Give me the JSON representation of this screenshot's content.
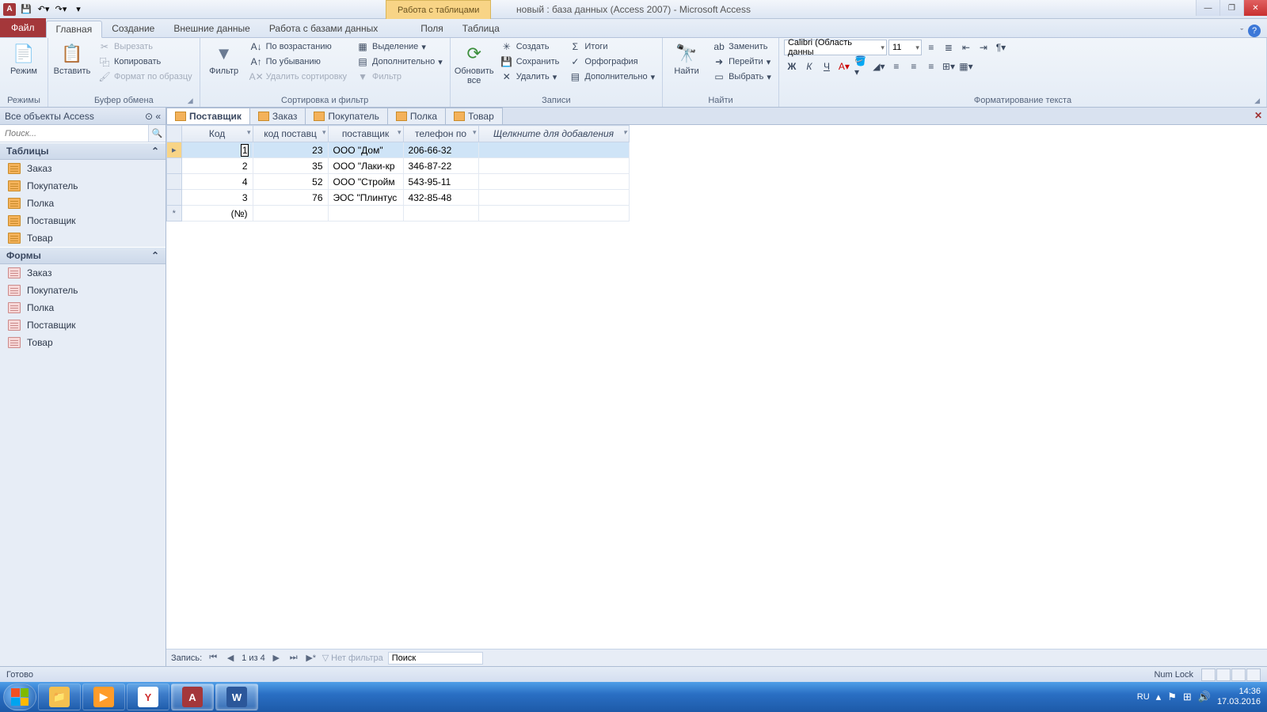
{
  "title": "новый : база данных (Access 2007)  -  Microsoft Access",
  "table_tools_label": "Работа с таблицами",
  "ribbon_tabs": {
    "file": "Файл",
    "items": [
      "Главная",
      "Создание",
      "Внешние данные",
      "Работа с базами данных",
      "Поля",
      "Таблица"
    ],
    "active_index": 0
  },
  "ribbon": {
    "modes": {
      "big": "Режим",
      "group": "Режимы"
    },
    "clipboard": {
      "big": "Вставить",
      "cut": "Вырезать",
      "copy": "Копировать",
      "format": "Формат по образцу",
      "group": "Буфер обмена"
    },
    "sort": {
      "filter": "Фильтр",
      "asc": "По возрастанию",
      "desc": "По убыванию",
      "clear": "Удалить сортировку",
      "group": "Сортировка и фильтр",
      "select": "Выделение",
      "adv": "Дополнительно",
      "toggle": "Фильтр"
    },
    "records": {
      "refresh": "Обновить\nвсе",
      "new": "Создать",
      "save": "Сохранить",
      "delete": "Удалить",
      "totals": "Итоги",
      "spell": "Орфография",
      "more": "Дополнительно",
      "group": "Записи"
    },
    "find": {
      "find": "Найти",
      "replace": "Заменить",
      "goto": "Перейти",
      "select": "Выбрать",
      "group": "Найти"
    },
    "text": {
      "group": "Форматирование текста",
      "font": "Calibri (Область данны",
      "size": "11"
    }
  },
  "nav": {
    "header": "Все объекты Access",
    "search_ph": "Поиск...",
    "groups": [
      {
        "title": "Таблицы",
        "items": [
          "Заказ",
          "Покупатель",
          "Полка",
          "Поставщик",
          "Товар"
        ]
      },
      {
        "title": "Формы",
        "items": [
          "Заказ",
          "Покупатель",
          "Полка",
          "Поставщик",
          "Товар"
        ]
      }
    ]
  },
  "doc_tabs": [
    "Поставщик",
    "Заказ",
    "Покупатель",
    "Полка",
    "Товар"
  ],
  "doc_active": 0,
  "datasheet": {
    "columns": [
      "Код",
      "код поставц",
      "поставщик",
      "телефон по"
    ],
    "add_col": "Щелкните для добавления",
    "rows": [
      {
        "sel": true,
        "id": "1",
        "code": "23",
        "name": "ООО \"Дом\"",
        "phone": "206-66-32"
      },
      {
        "id": "2",
        "code": "35",
        "name": "ООО \"Лаки-кр",
        "phone": "346-87-22"
      },
      {
        "id": "4",
        "code": "52",
        "name": "ООО \"Стройм",
        "phone": "543-95-11"
      },
      {
        "id": "3",
        "code": "76",
        "name": "ЭОС \"Плинтус",
        "phone": "432-85-48"
      }
    ],
    "new_row": "(№)"
  },
  "recnav": {
    "label": "Запись:",
    "pos": "1 из 4",
    "nofilter": "Нет фильтра",
    "search": "Поиск"
  },
  "status": {
    "ready": "Готово",
    "numlock": "Num Lock"
  },
  "tray": {
    "lang": "RU",
    "time": "14:36",
    "date": "17.03.2016"
  }
}
